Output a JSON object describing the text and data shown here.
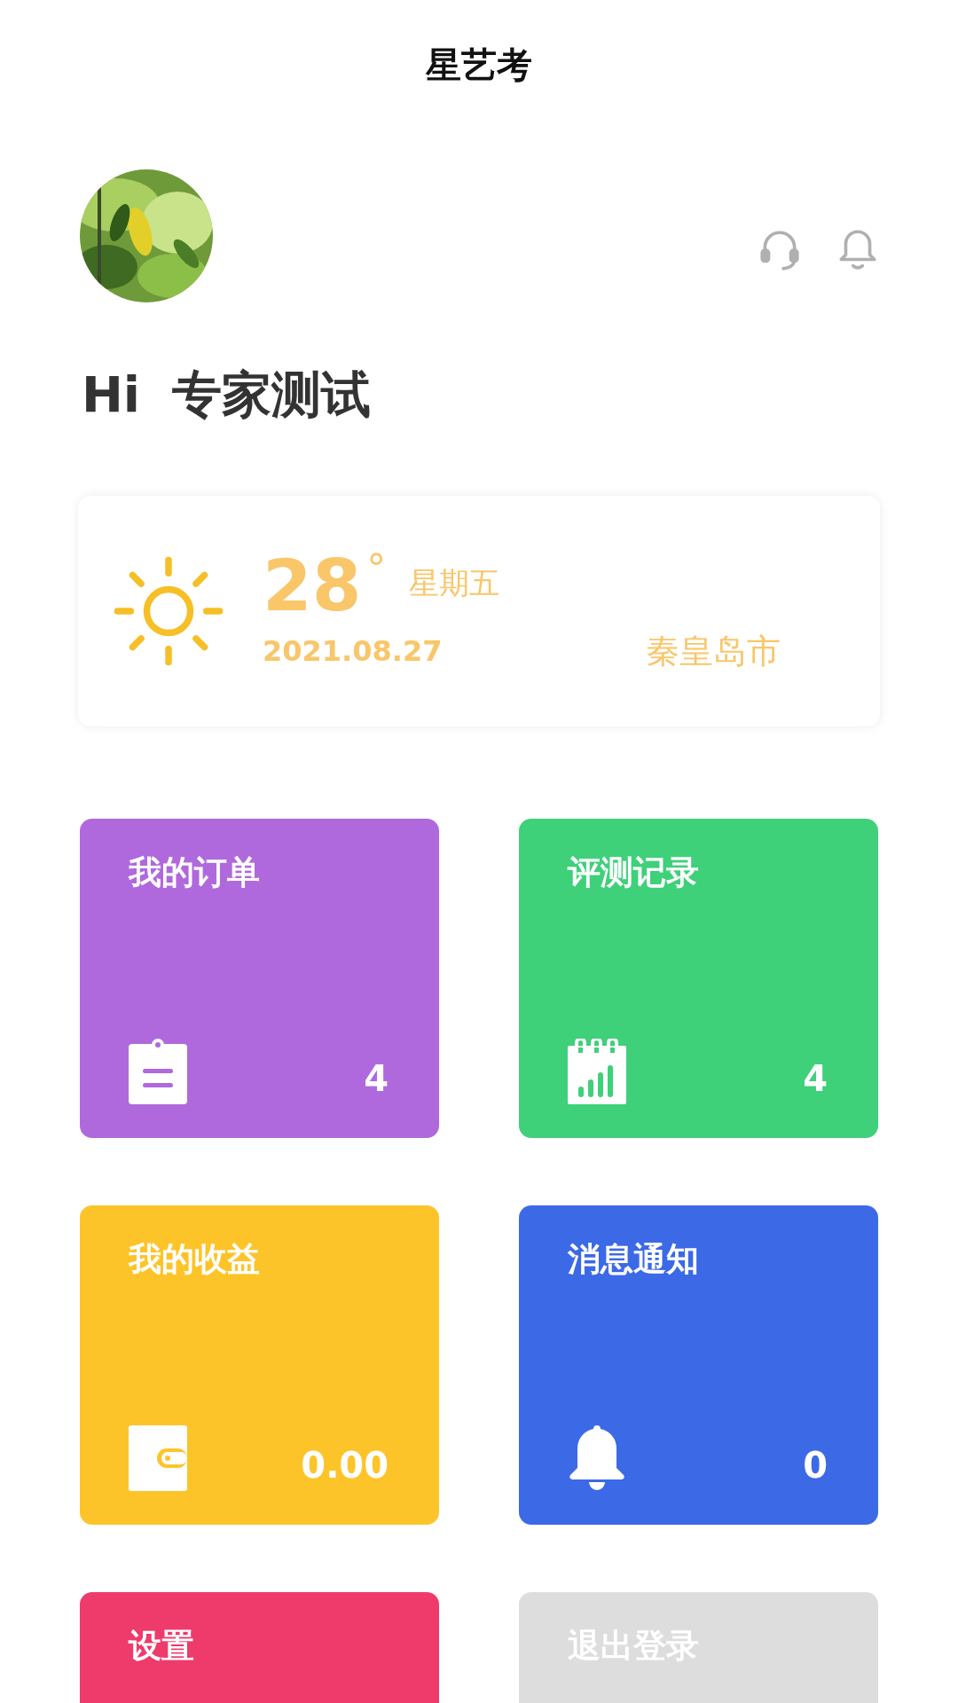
{
  "app_bar": {
    "title": "星艺考"
  },
  "profile": {
    "greeting": "Hi",
    "name": "专家测试"
  },
  "weather": {
    "temperature": "28",
    "degree_sign": "°",
    "weekday": "星期五",
    "date": "2021.08.27",
    "city": "秦皇岛市"
  },
  "tiles": [
    {
      "title": "我的订单",
      "count": "4",
      "color": "#af69dd"
    },
    {
      "title": "评测记录",
      "count": "4",
      "color": "#3fd07a"
    },
    {
      "title": "我的收益",
      "count": "0.00",
      "color": "#fdc42a"
    },
    {
      "title": "消息通知",
      "count": "0",
      "color": "#3c69e6"
    },
    {
      "title": "设置",
      "color": "#ef3a6c"
    },
    {
      "title": "退出登录",
      "color": "#dddddd"
    }
  ]
}
